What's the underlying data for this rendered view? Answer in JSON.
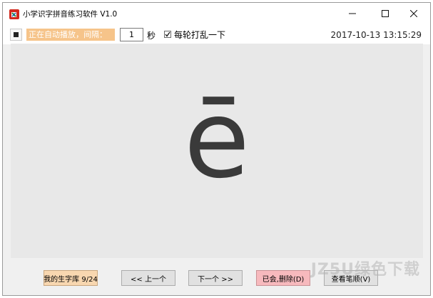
{
  "window": {
    "title": "小学识字拼音练习软件 V1.0"
  },
  "toolbar": {
    "status_text": "正在自动播放，间隔：",
    "interval_value": "1",
    "seconds_label": "秒",
    "shuffle_checked": true,
    "shuffle_label": "每轮打乱一下",
    "datetime": "2017-10-13 13:15:29"
  },
  "display": {
    "current_pinyin": "ē"
  },
  "buttons": {
    "library": "我的生字库 9/24",
    "prev": "<< 上一个",
    "next": "下一个 >>",
    "mastered": "已会,删除(D)",
    "strokes": "查看笔顺(V)"
  },
  "watermark": {
    "text": "JZ5U绿色下载"
  },
  "colors": {
    "status_bg": "#f6c48a",
    "library_btn": "#f8d7b0",
    "mastered_btn": "#f7b9bd",
    "display_bg": "#e8e8e8"
  }
}
